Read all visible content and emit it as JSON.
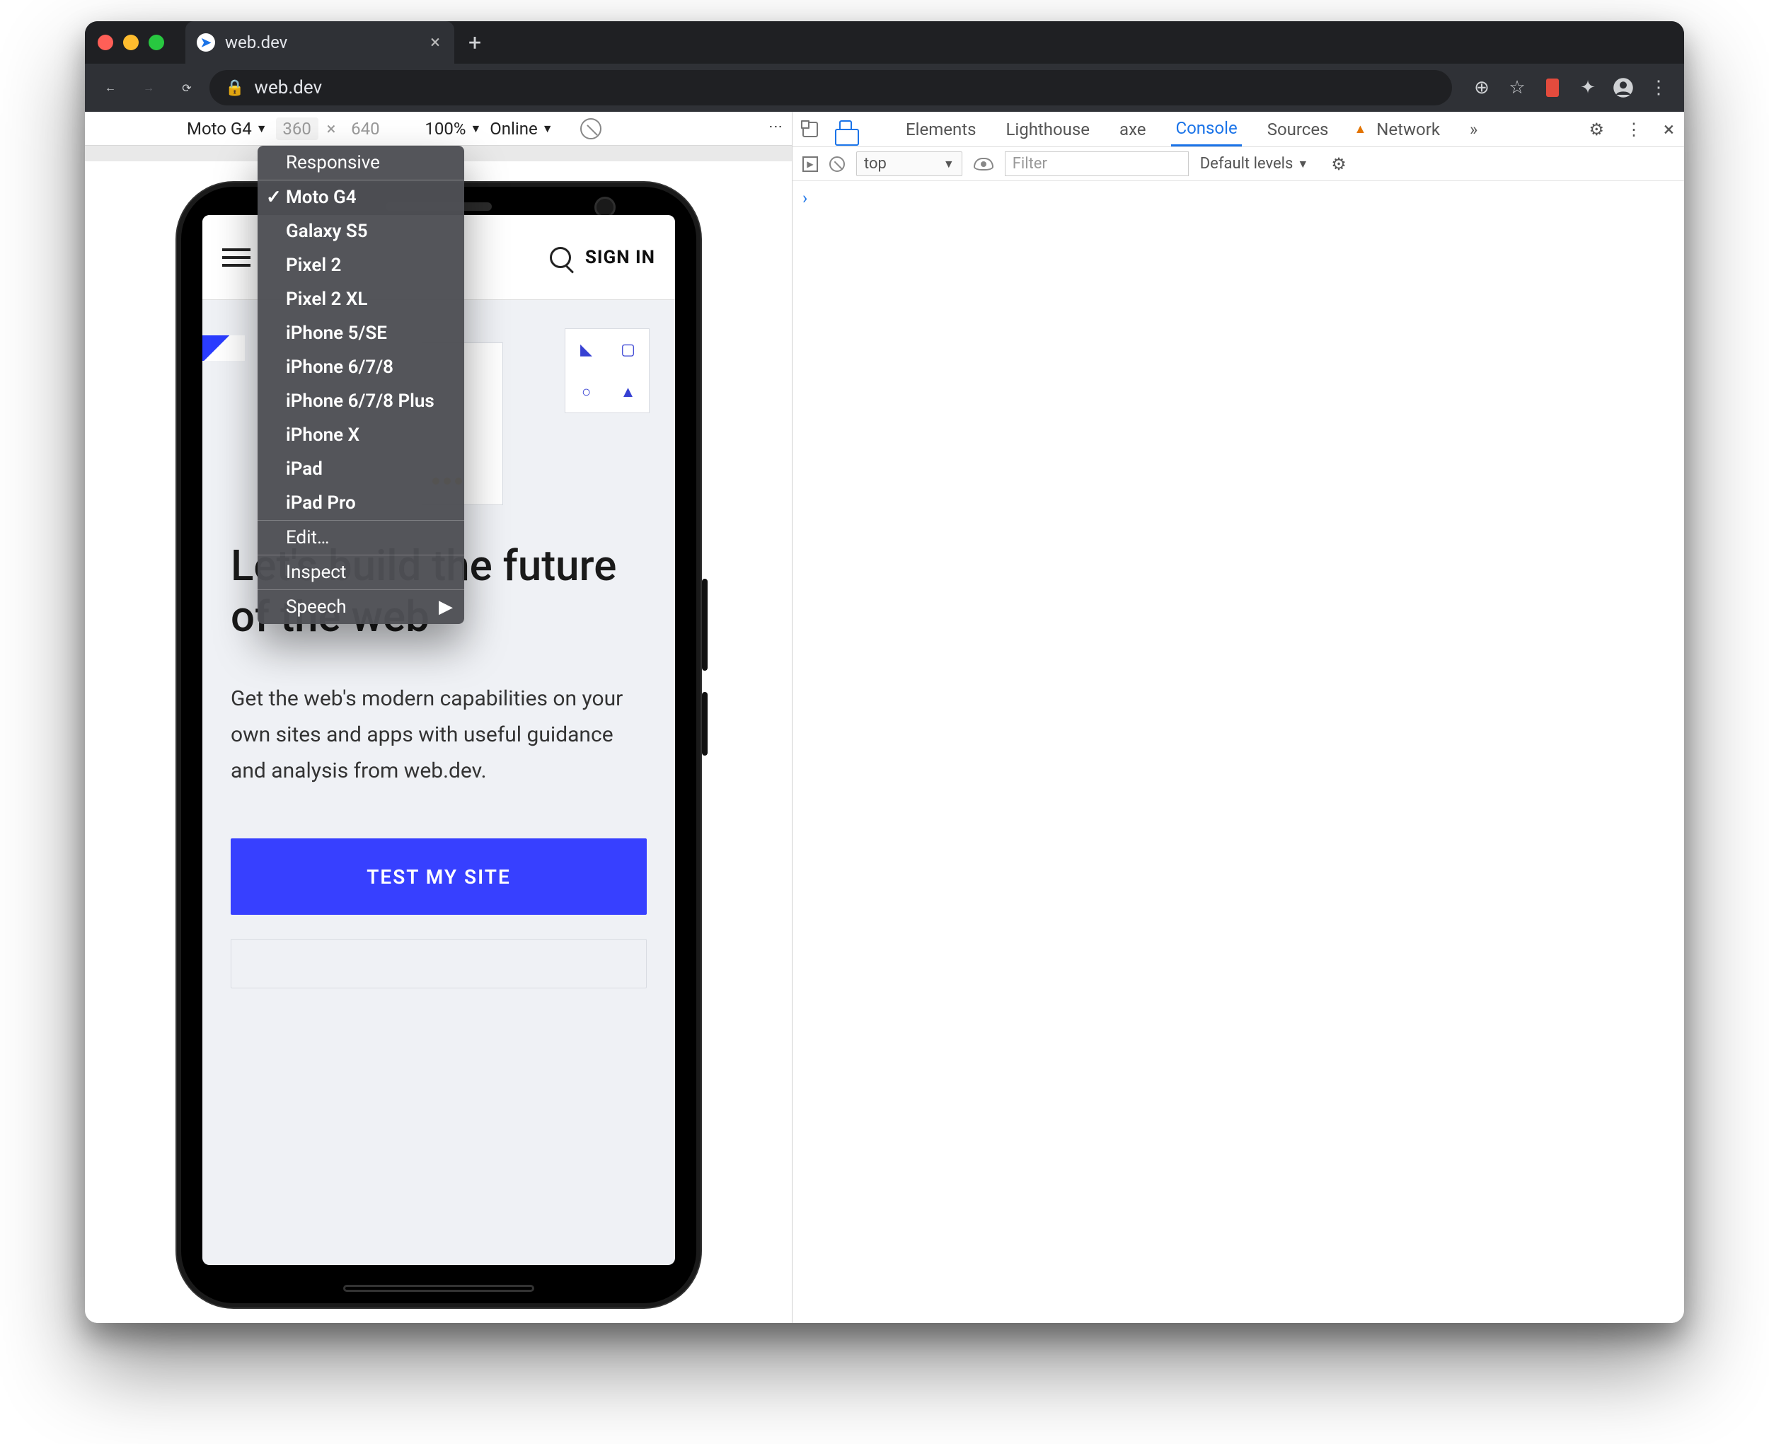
{
  "browser": {
    "tab_title": "web.dev",
    "url": "web.dev",
    "icons": {
      "new_tab": "+",
      "back": "←",
      "forward": "→",
      "reload": "⟳",
      "lock": "🔒",
      "add": "⊕",
      "star": "☆",
      "puzzle": "✦",
      "avatar": "◉",
      "menu": "⋮"
    }
  },
  "device_toolbar": {
    "device_name": "Moto G4",
    "width": "360",
    "height": "640",
    "zoom": "100%",
    "throttle": "Online"
  },
  "device_menu": {
    "responsive": "Responsive",
    "devices": [
      "Moto G4",
      "Galaxy S5",
      "Pixel 2",
      "Pixel 2 XL",
      "iPhone 5/SE",
      "iPhone 6/7/8",
      "iPhone 6/7/8 Plus",
      "iPhone X",
      "iPad",
      "iPad Pro"
    ],
    "edit": "Edit…",
    "inspect": "Inspect",
    "speech": "Speech",
    "selected": "Moto G4"
  },
  "site": {
    "sign_in": "SIGN IN",
    "headline": "Let's build the future of the web",
    "subhead": "Get the web's modern capabilities on your own sites and apps with useful guidance and analysis from web.dev.",
    "cta": "TEST MY SITE"
  },
  "devtools": {
    "tabs": [
      "Elements",
      "Lighthouse",
      "axe",
      "Console",
      "Sources",
      "Network"
    ],
    "active_tab": "Console",
    "more": "»",
    "console": {
      "context": "top",
      "filter_placeholder": "Filter",
      "levels": "Default levels",
      "prompt": "›"
    }
  }
}
